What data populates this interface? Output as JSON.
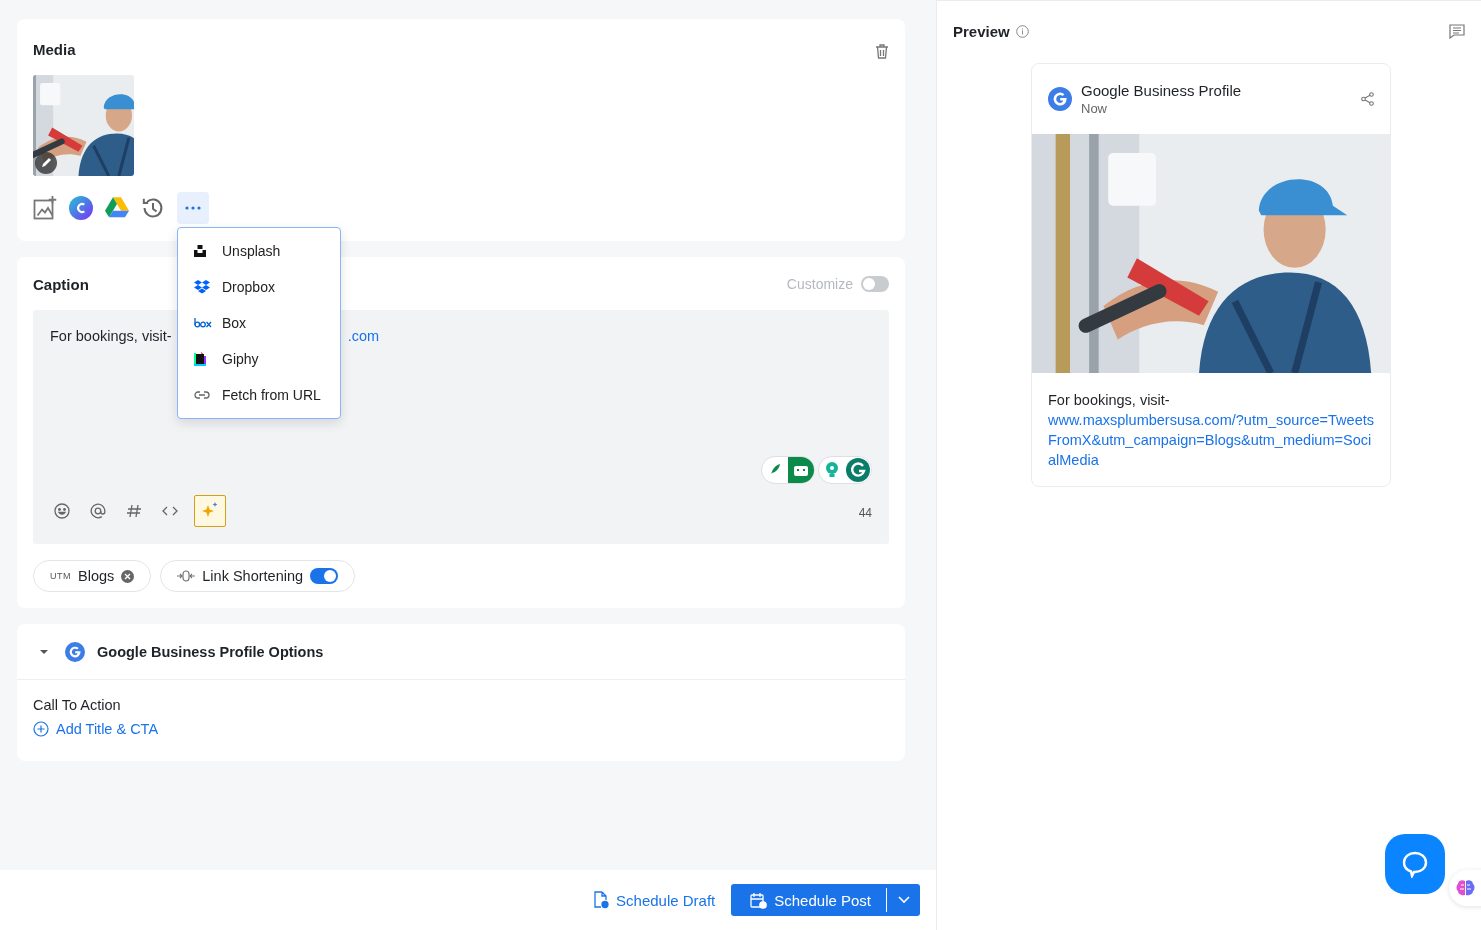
{
  "media": {
    "title": "Media"
  },
  "source_menu": {
    "items": [
      {
        "kind": "unsplash",
        "label": "Unsplash"
      },
      {
        "kind": "dropbox",
        "label": "Dropbox"
      },
      {
        "kind": "box",
        "label": "Box"
      },
      {
        "kind": "giphy",
        "label": "Giphy"
      },
      {
        "kind": "url",
        "label": "Fetch from URL"
      }
    ]
  },
  "caption": {
    "title": "Caption",
    "customize": {
      "label": "Customize",
      "on": false
    },
    "text": "For bookings, visit-",
    "link_tail": ".com",
    "char_count": "44",
    "utm_chip": {
      "prefix": "UTM",
      "label": "Blogs"
    },
    "link_shortening": {
      "label": "Link Shortening",
      "on": true
    }
  },
  "gbp_options": {
    "title": "Google Business Profile Options",
    "expanded": true,
    "cta_label": "Call To Action",
    "add_link": "Add Title & CTA"
  },
  "preview": {
    "title": "Preview",
    "card": {
      "account": "Google Business Profile",
      "time": "Now",
      "text": "For bookings, visit-",
      "link": "www.maxsplumbersusa.com/?utm_source=TweetsFromX&utm_campaign=Blogs&utm_medium=SocialMedia"
    }
  },
  "footer": {
    "draft_button": "Schedule Draft",
    "post_button": "Schedule Post"
  }
}
